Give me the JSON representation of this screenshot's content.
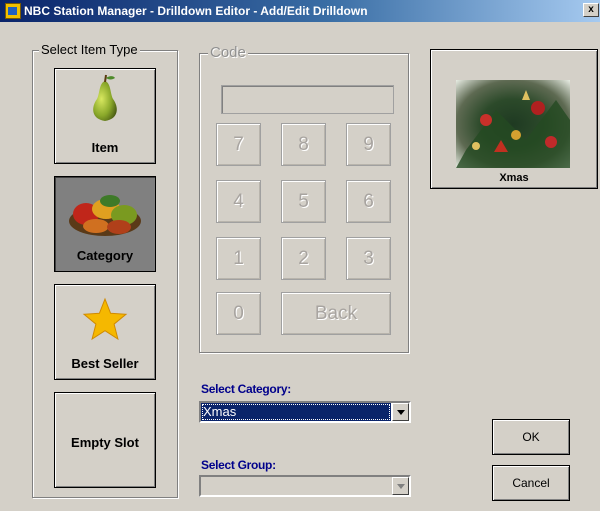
{
  "window": {
    "title": "NBC Station Manager - Drilldown Editor - Add/Edit Drilldown",
    "close_label": "x"
  },
  "item_type": {
    "legend": "Select Item Type",
    "tiles": [
      {
        "label": "Item",
        "icon": "pear-icon",
        "selected": false
      },
      {
        "label": "Category",
        "icon": "vegetables-image",
        "selected": true
      },
      {
        "label": "Best Seller",
        "icon": "star-icon",
        "selected": false
      },
      {
        "label": "Empty Slot",
        "icon": "",
        "selected": false
      }
    ]
  },
  "code": {
    "legend": "Code",
    "value": "",
    "keys": [
      "7",
      "8",
      "9",
      "4",
      "5",
      "6",
      "1",
      "2",
      "3",
      "0"
    ],
    "back_label": "Back"
  },
  "preview": {
    "label": "Xmas",
    "image": "christmas-tree-image"
  },
  "select_category": {
    "label": "Select Category:",
    "value": "Xmas"
  },
  "select_group": {
    "label": "Select Group:",
    "value": ""
  },
  "buttons": {
    "ok": "OK",
    "cancel": "Cancel"
  },
  "colors": {
    "title_bar": "#0a246a",
    "field_label": "#00008b",
    "selection": "#0a246a",
    "window": "#d4d0c8",
    "star": "#f5b800"
  }
}
